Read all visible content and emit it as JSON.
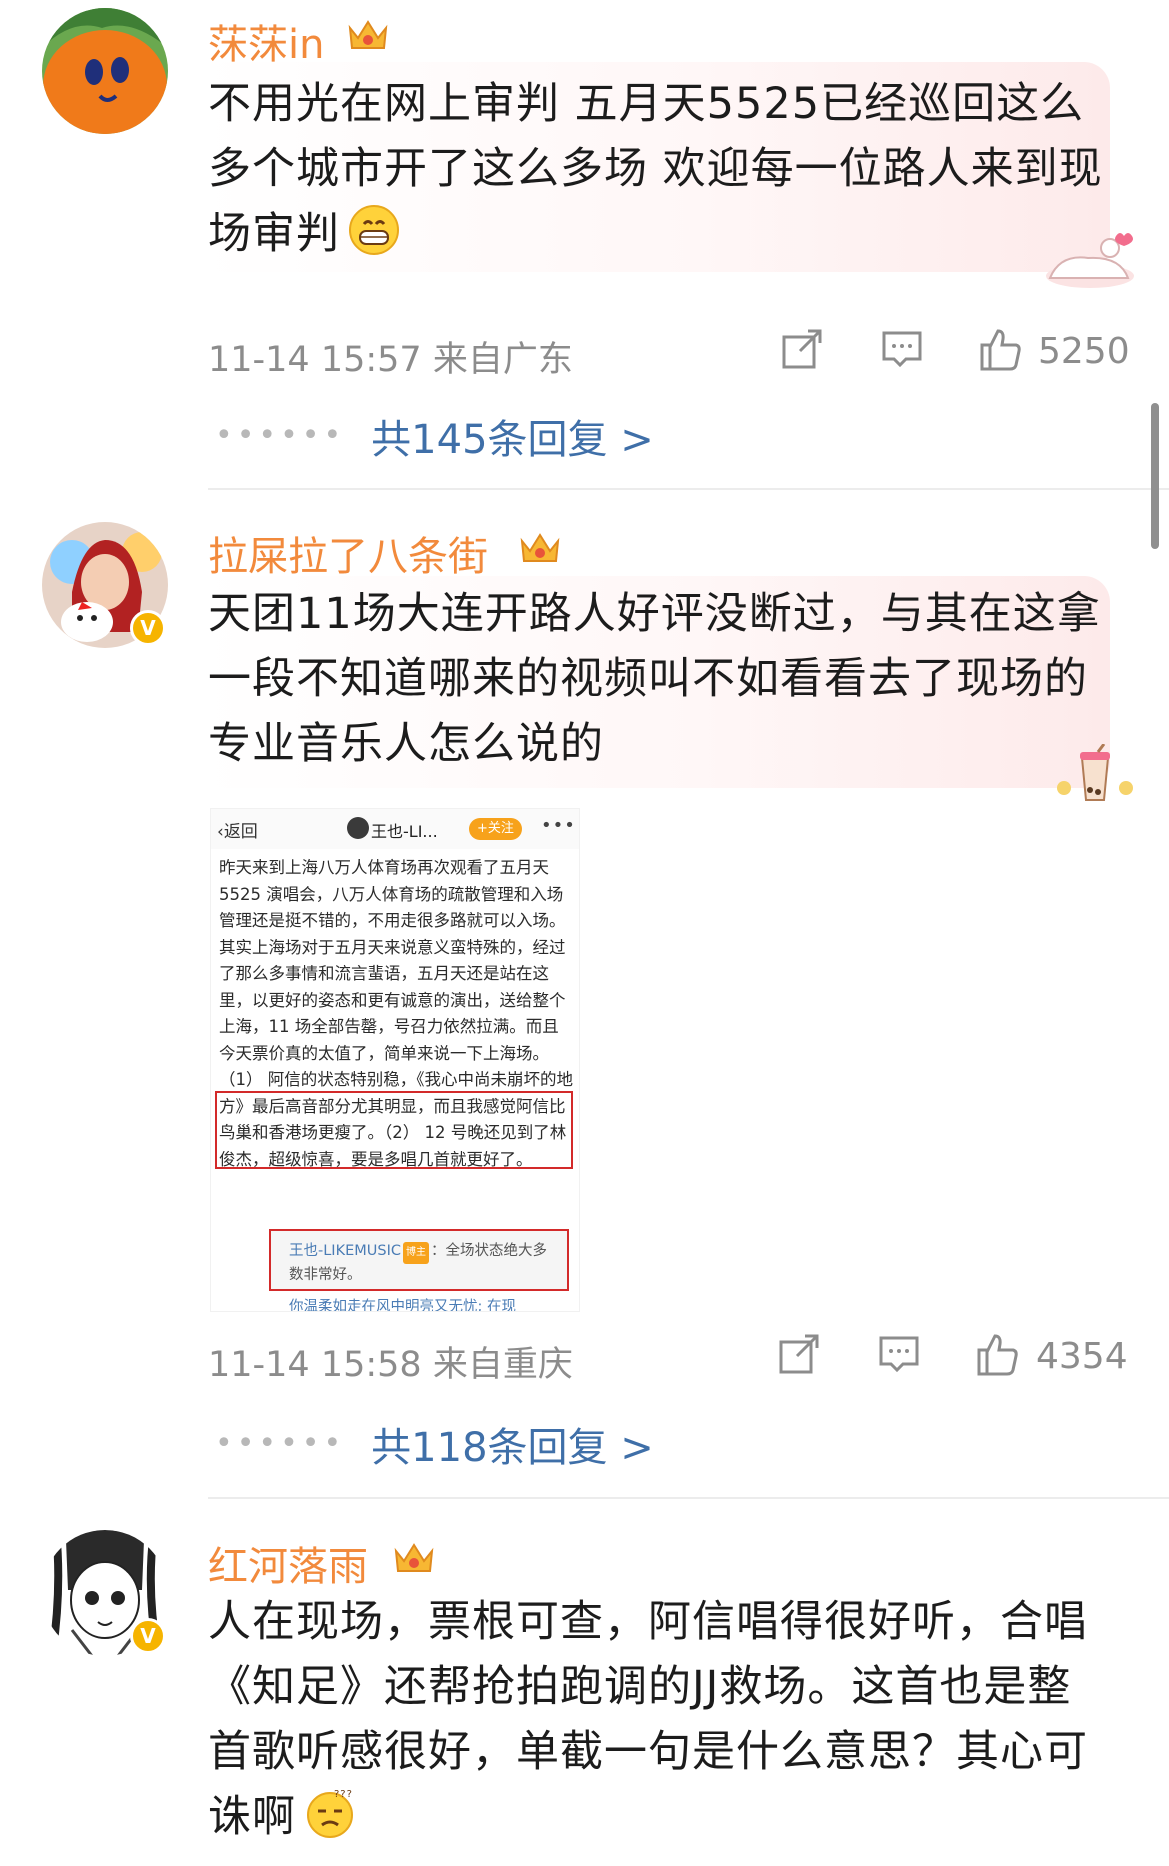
{
  "comments": [
    {
      "username": "莯莯in",
      "text": "不用光在网上审判 五月天5525已经巡回这么多个城市开了这么多场 欢迎每一位路人来到现场审判",
      "emoji": "grin-emoji",
      "meta": "11-14 15:57 来自广东",
      "likes": "5250",
      "replies": "共145条回复 >",
      "verified": false
    },
    {
      "username": "拉屎拉了八条街",
      "text": "天团11场大连开路人好评没断过，与其在这拿一段不知道哪来的视频叫不如看看去了现场的专业音乐人怎么说的",
      "meta": "11-14 15:58 来自重庆",
      "likes": "4354",
      "replies": "共118条回复 >",
      "verified": true
    },
    {
      "username": "红河落雨",
      "text": "人在现场，票根可查，阿信唱得很好听，合唱《知足》还帮抢拍跑调的JJ救场。这首也是整首歌听感很好，单截一句是什么意思？其心可诛啊",
      "emoji": "confused-emoji",
      "verified": true
    }
  ],
  "embedded_screenshot": {
    "back_label": "返回",
    "author": "王也-LI...",
    "follow_label": "+关注",
    "more": "•••",
    "body": "昨天来到上海八万人体育场再次观看了五月天 5525 演唱会，八万人体育场的疏散管理和入场管理还是挺不错的，不用走很多路就可以入场。其实上海场对于五月天来说意义蛮特殊的，经过了那么多事情和流言蜚语，五月天还是站在这里，以更好的姿态和更有诚意的演出，送给整个上海，11 场全部告罄，号召力依然拉满。而且今天票价真的太值了，简单来说一下上海场。（1） 阿信的状态特别稳，《我心中尚未崩坏的地方》最后高音部分尤其明显，而且我感觉阿信比鸟巢和香港场更瘦了。（2） 12 号晚还见到了林俊杰，超级惊喜，要是多唱几首就更好了。",
    "reply_user": "王也-LIKEMUSIC",
    "reply_badge": "博主",
    "reply_text": "：全场状态绝大多数非常好。",
    "tail_text": "你温柔如走在风中明亮又无忧; 在现"
  }
}
